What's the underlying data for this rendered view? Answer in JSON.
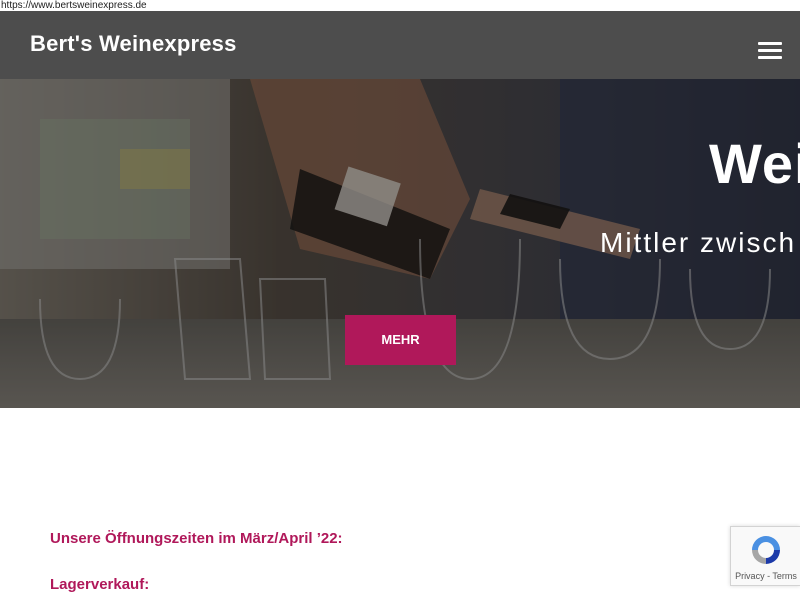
{
  "browser": {
    "url": "https://www.bertsweinexpress.de"
  },
  "header": {
    "brand": "Bert's Weinexpress",
    "menu_icon": "hamburger-menu-icon"
  },
  "hero": {
    "title": "Wei",
    "subtitle": "Mittler zwisch",
    "button_label": "MEHR",
    "accent_color": "#b0185a"
  },
  "content": {
    "hours_heading": "Unsere Öffnungszeiten im März/April ’22:",
    "lagerverkauf_heading": "Lagerverkauf:"
  },
  "recaptcha": {
    "icon": "recaptcha-logo-icon",
    "privacy": "Privacy",
    "separator": " - ",
    "terms": "Terms"
  }
}
